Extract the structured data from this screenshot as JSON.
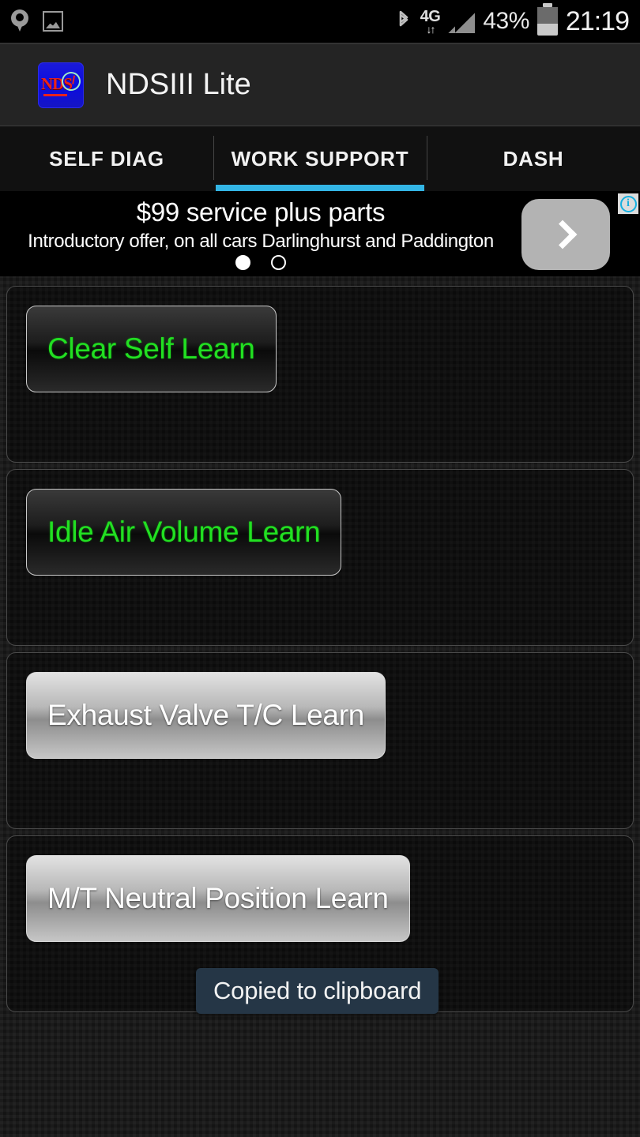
{
  "statusbar": {
    "left_icons": [
      {
        "name": "location-pin-icon"
      },
      {
        "name": "screenshot-image-icon"
      }
    ],
    "bluetooth_icon": "bluetooth-icon",
    "network_type": "4G",
    "network_arrows": "↓↑",
    "signal_icon": "signal-bars-icon",
    "battery_percent": "43%",
    "battery_icon": "battery-icon",
    "time": "21:19"
  },
  "actionbar": {
    "app_icon_label": "NDS",
    "title": "NDSIII Lite"
  },
  "tabs": {
    "items": [
      {
        "label": "SELF DIAG",
        "active": false
      },
      {
        "label": "WORK SUPPORT",
        "active": true
      },
      {
        "label": "DASH",
        "active": false
      }
    ],
    "active_indicator_color": "#33b5e5"
  },
  "ad": {
    "headline": "$99 service plus parts",
    "subtext": "Introductory offer, on all cars Darlinghurst and Paddington",
    "next_button_label": "chevron-right-icon",
    "info_badge": "i",
    "dots": [
      {
        "filled": true
      },
      {
        "filled": false
      }
    ]
  },
  "main": {
    "cards": [
      {
        "button_label": "Clear Self Learn",
        "style": "dark"
      },
      {
        "button_label": "Idle Air Volume Learn",
        "style": "dark"
      },
      {
        "button_label": "Exhaust Valve T/C Learn",
        "style": "light"
      },
      {
        "button_label": "M/T Neutral Position Learn",
        "style": "light"
      }
    ]
  },
  "toast": {
    "message": "Copied to clipboard",
    "background_color": "#253646"
  },
  "colors": {
    "accent_blue": "#33b5e5",
    "button_green_text": "#22e022",
    "action_bar": "#242424",
    "carbon_background": "#141414"
  }
}
